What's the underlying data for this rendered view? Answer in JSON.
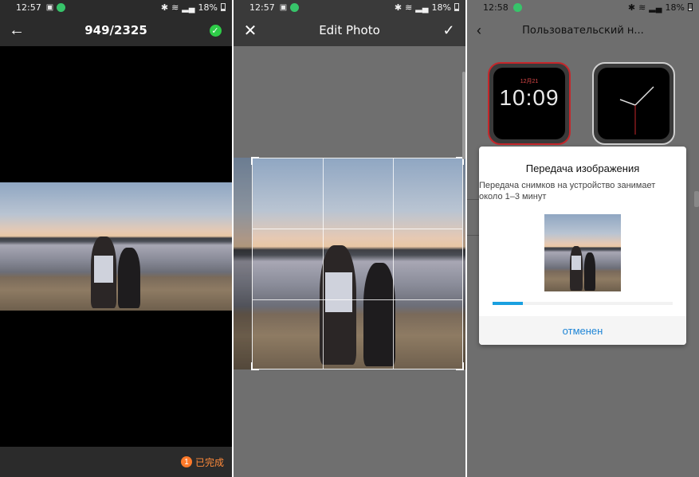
{
  "panel1": {
    "status": {
      "time": "12:57",
      "battery": "18%"
    },
    "counter": "949/2325",
    "done_badge": "1",
    "done_label": "已完成"
  },
  "panel2": {
    "status": {
      "time": "12:57",
      "battery": "18%"
    },
    "title": "Edit Photo"
  },
  "panel3": {
    "status": {
      "time": "12:58",
      "battery": "18%"
    },
    "title": "Пользовательский н...",
    "watch_digital": {
      "date": "12月21",
      "time": "10:09"
    },
    "dialog": {
      "title": "Передача изображения",
      "message": "Передача снимков на устройство занимает около 1–3 минут",
      "progress": 0.17,
      "cancel_label": "отменен"
    }
  },
  "icons": {
    "back": "arrow-left-icon",
    "confirm": "check-circle-icon",
    "close": "close-icon",
    "accept": "checkmark-icon"
  },
  "colors": {
    "accent_orange": "#ff7a2a",
    "accent_green": "#2ecc48",
    "accent_blue": "#2086d6",
    "watch_red": "#c5262a"
  }
}
